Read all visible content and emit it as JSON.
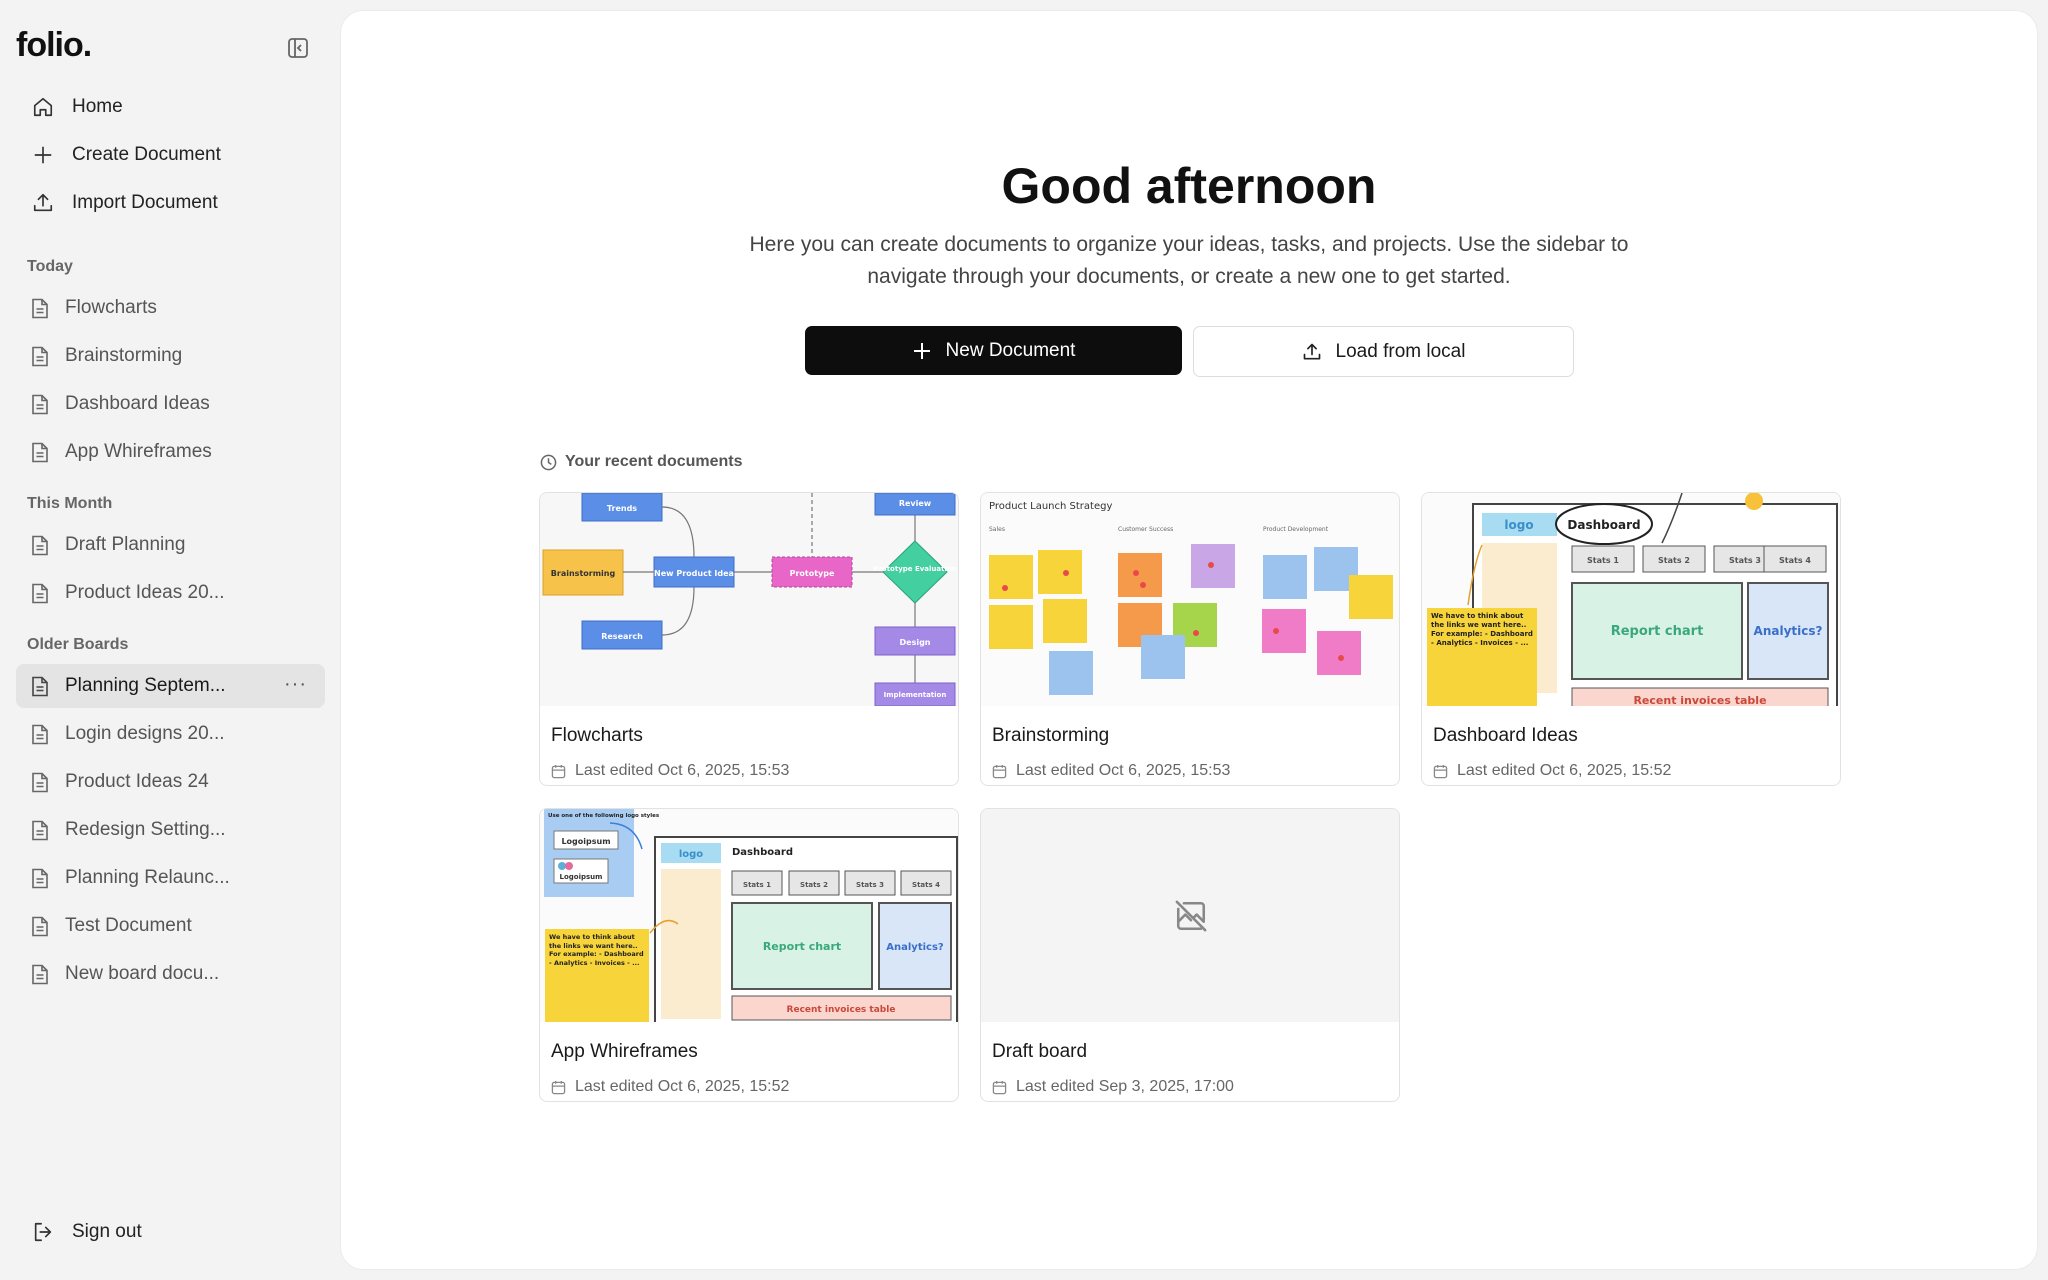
{
  "app": {
    "logo": "folio."
  },
  "sidebar": {
    "nav": [
      {
        "label": "Home",
        "icon": "home-icon"
      },
      {
        "label": "Create Document",
        "icon": "plus-icon"
      },
      {
        "label": "Import Document",
        "icon": "upload-icon"
      }
    ],
    "sections": [
      {
        "label": "Today",
        "items": [
          "Flowcharts",
          "Brainstorming",
          "Dashboard Ideas",
          "App Whireframes"
        ]
      },
      {
        "label": "This Month",
        "items": [
          "Draft Planning",
          "Product Ideas 20..."
        ]
      },
      {
        "label": "Older Boards",
        "items": [
          "Planning Septem...",
          "Login designs 20...",
          "Product Ideas 24",
          "Redesign Setting...",
          "Planning Relaunc...",
          "Test Document",
          "New board docu..."
        ]
      }
    ],
    "active_item": "Planning Septem...",
    "more_label": "···",
    "signout": "Sign out"
  },
  "main": {
    "greeting": "Good afternoon",
    "subtitle": "Here you can create documents to organize your ideas, tasks, and projects. Use the sidebar to navigate through your documents, or create a new one to get started.",
    "new_button": "New Document",
    "load_button": "Load from local",
    "recent_label": "Your recent documents",
    "cards": [
      {
        "title": "Flowcharts",
        "meta": "Last edited Oct 6, 2025, 15:53"
      },
      {
        "title": "Brainstorming",
        "meta": "Last edited Oct 6, 2025, 15:53"
      },
      {
        "title": "Dashboard Ideas",
        "meta": "Last edited Oct 6, 2025, 15:52"
      },
      {
        "title": "App Whireframes",
        "meta": "Last edited Oct 6, 2025, 15:52"
      },
      {
        "title": "Draft board",
        "meta": "Last edited Sep 3, 2025, 17:00"
      }
    ]
  },
  "thumbs": {
    "flowcharts": {
      "trends": "Trends",
      "brainstorming": "Brainstorming",
      "new_idea": "New Product Idea",
      "prototype": "Prototype",
      "eval": "Prototype Evaluation",
      "research": "Research",
      "review": "Review",
      "design": "Design",
      "impl": "Implementation"
    },
    "brainstorming": {
      "title": "Product Launch Strategy",
      "col1": "Sales",
      "col2": "Customer Success",
      "col3": "Product Development"
    },
    "dashboard": {
      "logo": "logo",
      "dashboard": "Dashboard",
      "stats": [
        "Stats 1",
        "Stats 2",
        "Stats 3",
        "Stats 4"
      ],
      "report": "Report chart",
      "analytics": "Analytics?",
      "invoices": "Recent invoices table",
      "note": "We have to think about the links we want here.. For example: - Dashboard - Analytics - Invoices - ..."
    },
    "wireframes": {
      "note_top": "Use one of the following logo styles",
      "logoipsum": "Logoipsum",
      "logo": "logo",
      "dashboard": "Dashboard",
      "stats": [
        "Stats 1",
        "Stats 2",
        "Stats 3",
        "Stats 4"
      ],
      "report": "Report chart",
      "analytics": "Analytics?",
      "invoices": "Recent invoices table",
      "note": "We have to think about the links we want here.. For example: - Dashboard - Analytics - Invoices - ..."
    }
  },
  "colors": {
    "accent_button": "#0d0d0d",
    "sidebar_bg": "#f3f3f3",
    "active_item_bg": "#e4e4e4"
  }
}
